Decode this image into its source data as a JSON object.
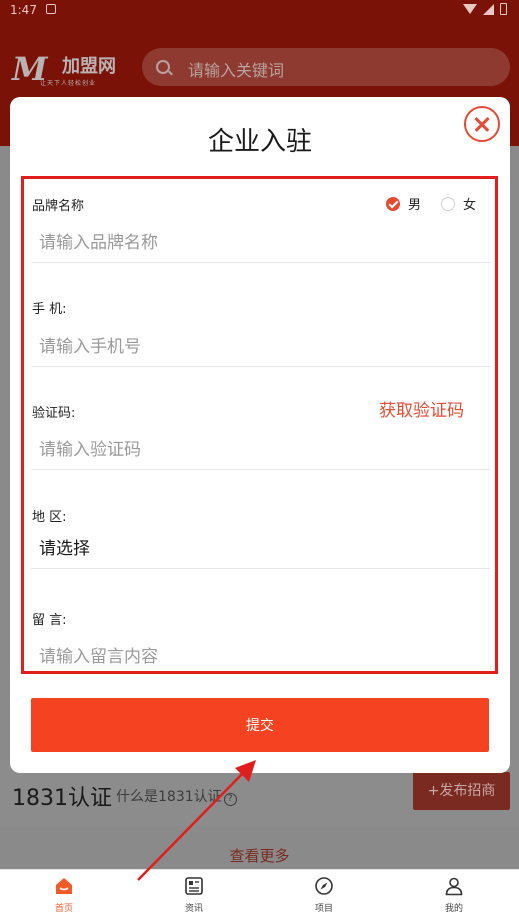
{
  "status_bar": {
    "time": "1:47"
  },
  "header": {
    "logo_text": "加盟网",
    "logo_sub": "让天下人轻松创业",
    "search_placeholder": "请输入关键词"
  },
  "background": {
    "cert_title": "1831认证",
    "cert_question": "什么是1831认证",
    "publish_label": "+发布招商",
    "see_more": "查看更多"
  },
  "modal": {
    "title": "企业入驻",
    "fields": {
      "brand": {
        "label": "品牌名称",
        "placeholder": "请输入品牌名称"
      },
      "gender": {
        "options": [
          "男",
          "女"
        ],
        "selected": "男"
      },
      "phone": {
        "label": "手 机:",
        "placeholder": "请输入手机号"
      },
      "code": {
        "label": "验证码:",
        "placeholder": "请输入验证码",
        "get_code_label": "获取验证码"
      },
      "region": {
        "label": "地 区:",
        "value": "请选择"
      },
      "message": {
        "label": "留 言:",
        "placeholder": "请输入留言内容"
      }
    },
    "submit_label": "提交"
  },
  "tabbar": {
    "items": [
      {
        "label": "首页",
        "icon": "home-icon",
        "active": true
      },
      {
        "label": "资讯",
        "icon": "news-icon",
        "active": false
      },
      {
        "label": "项目",
        "icon": "compass-icon",
        "active": false
      },
      {
        "label": "我的",
        "icon": "user-icon",
        "active": false
      }
    ]
  },
  "colors": {
    "accent": "#f54321",
    "highlight_border": "#e01e1e",
    "header": "#c81e0a"
  }
}
